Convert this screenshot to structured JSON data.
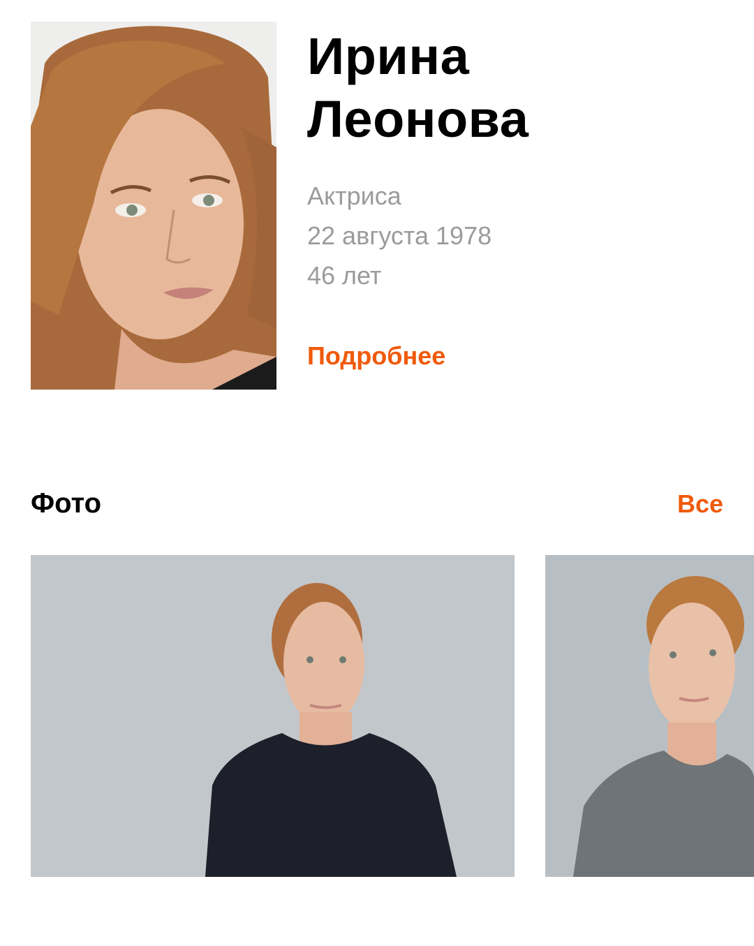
{
  "person": {
    "first_name": "Ирина",
    "last_name": "Леонова",
    "profession": "Актриса",
    "birth_date": "22 августа 1978",
    "age": "46 лет",
    "more_link": "Подробнее"
  },
  "photos_section": {
    "title": "Фото",
    "all_link": "Все"
  },
  "colors": {
    "accent": "#f05a0b",
    "secondary_text": "#9b9b9b",
    "primary_text": "#000000"
  }
}
